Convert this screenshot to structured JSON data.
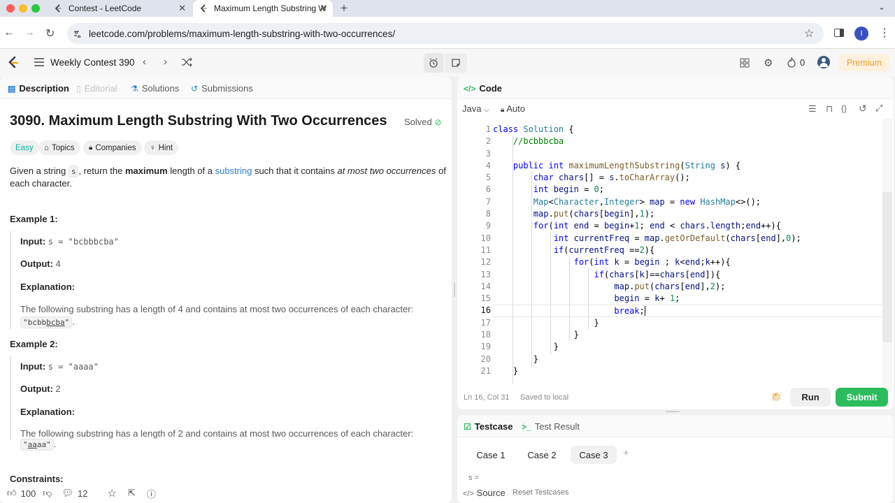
{
  "browser": {
    "tabs": [
      {
        "label": "Contest - LeetCode"
      },
      {
        "label": "Maximum Length Substring W"
      }
    ],
    "url": "leetcode.com/problems/maximum-length-substring-with-two-occurrences/",
    "profile_initial": "I"
  },
  "header": {
    "contest_title": "Weekly Contest 390",
    "streak_count": "0",
    "premium_label": "Premium"
  },
  "left": {
    "tabs": [
      "Description",
      "Editorial",
      "Solutions",
      "Submissions"
    ],
    "title": "3090. Maximum Length Substring With Two Occurrences",
    "solved_label": "Solved",
    "tags": [
      "Easy",
      "Topics",
      "Companies",
      "Hint"
    ],
    "desc": {
      "p1": "Given a string ",
      "p1_code": "s",
      "p2": ", return the ",
      "p2_bold": "maximum",
      "p3": " length of a ",
      "p3_link": "substring",
      "p4": " such that it contains ",
      "p4_italic": "at most two occurrences",
      "p5": " of",
      "line2": "each character."
    },
    "ex1": {
      "heading": "Example 1:",
      "input_label": "Input:",
      "input_value": "s = \"bcbbbcba\"",
      "output_label": "Output:",
      "output_value": "4",
      "expl_label": "Explanation:",
      "expl_text": "The following substring has a length of 4 and contains at most two occurrences of each character:",
      "expl_code_pre": "\"bcbb",
      "expl_code_ul": "bcba",
      "expl_code_post": "\"",
      "expl_end": "."
    },
    "ex2": {
      "heading": "Example 2:",
      "input_label": "Input:",
      "input_value": "s = \"aaaa\"",
      "output_label": "Output:",
      "output_value": "2",
      "expl_label": "Explanation:",
      "expl_text": "The following substring has a length of 2 and contains at most two occurrences of each character: ",
      "expl_code_pre": "\"",
      "expl_code_ul": "aa",
      "expl_code_post": "aa\"",
      "expl_end": "."
    },
    "constraints_heading": "Constraints:",
    "footer": {
      "likes": "100",
      "comments": "12"
    }
  },
  "editor": {
    "tab_label": "Code",
    "language": "Java",
    "mode": "Auto",
    "status_pos": "Ln 16, Col 31",
    "status_saved": "Saved to local",
    "run_label": "Run",
    "submit_label": "Submit",
    "active_line": 16
  },
  "bottom": {
    "tabs": [
      "Testcase",
      "Test Result"
    ],
    "cases": [
      "Case 1",
      "Case 2",
      "Case 3"
    ],
    "active_case": "Case 3",
    "input_label": "s =",
    "source_label": "Source",
    "reset_label": "Reset Testcases"
  },
  "colors": {
    "accent_green": "#2cbb5d",
    "easy_teal": "#00b8a3",
    "link_blue": "#2a7fd4",
    "premium_orange": "#e8a033"
  }
}
